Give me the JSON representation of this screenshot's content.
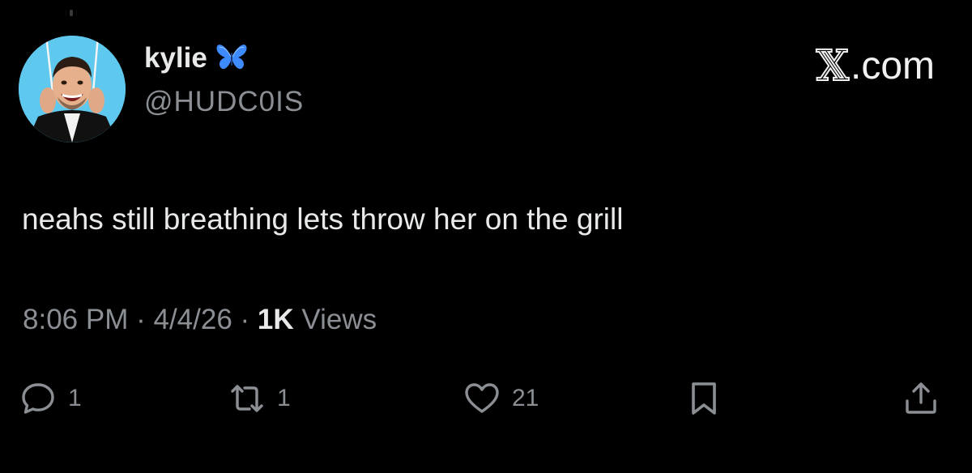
{
  "author": {
    "display_name": "kylie",
    "handle": "@HUDC0IS",
    "badge_icon": "butterfly-icon",
    "avatar_bg": "#5fc8ee"
  },
  "brand": {
    "label": ".com",
    "icon": "x-logo"
  },
  "tweet": {
    "text": "neahs still breathing lets throw her on the grill"
  },
  "meta": {
    "time": "8:06 PM",
    "date": "4/4/26",
    "separator": "·",
    "views_count": "1K",
    "views_label": "Views"
  },
  "actions": {
    "reply_count": "1",
    "retweet_count": "1",
    "like_count": "21"
  },
  "colors": {
    "background": "#000000",
    "primary_text": "#e7e9ea",
    "secondary_text": "#8b8f94",
    "butterfly": "#3d8bff"
  }
}
